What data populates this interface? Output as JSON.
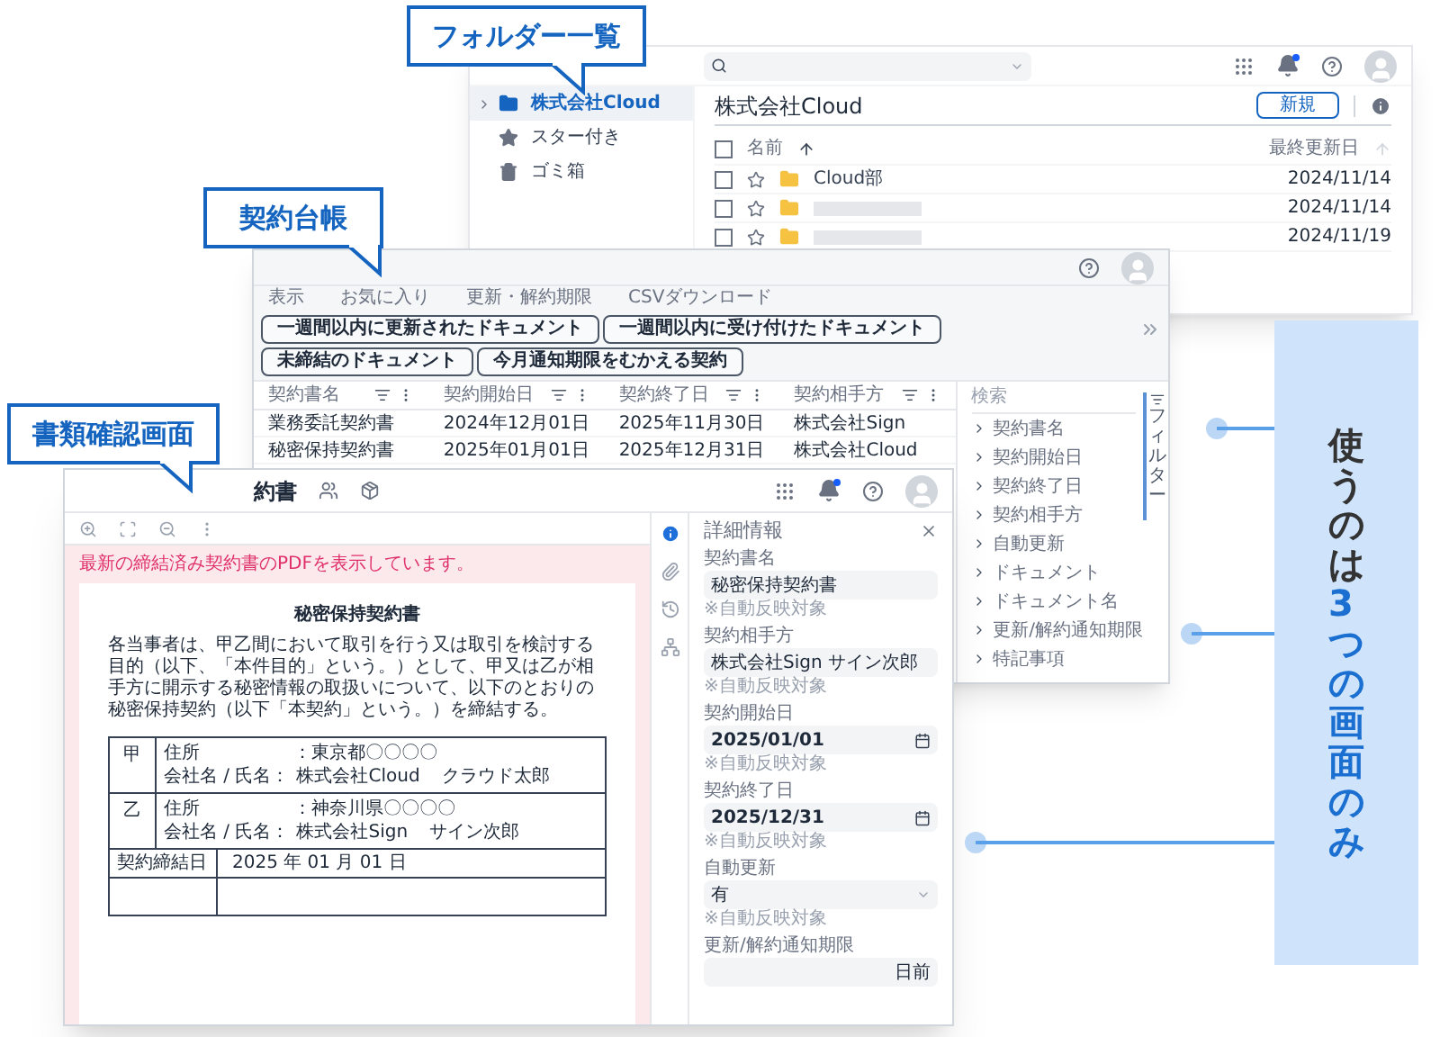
{
  "folder_list": {
    "callout": "フォルダー一覧",
    "notifications": true,
    "sidebar": [
      {
        "label": "株式会社Cloud",
        "kind": "folder",
        "selected": true
      },
      {
        "label": "スター付き",
        "kind": "starred",
        "selected": false
      },
      {
        "label": "ゴミ箱",
        "kind": "trash",
        "selected": false
      }
    ],
    "title": "株式会社Cloud",
    "new_button": "新規",
    "name_column": "名前",
    "date_column": "最終更新日",
    "header_checked": false,
    "rows": [
      {
        "name": "Cloud部",
        "date": "2024/11/14",
        "checked": false,
        "starred": false,
        "redacted": false
      },
      {
        "date": "2024/11/14",
        "checked": false,
        "starred": false,
        "redacted": true
      },
      {
        "date": "2024/11/19",
        "checked": false,
        "starred": false,
        "redacted": true
      }
    ]
  },
  "contract_ledger": {
    "callout": "契約台帳",
    "menu": [
      "表示",
      "お気に入り",
      "更新・解約期限",
      "CSVダウンロード"
    ],
    "chips": [
      "一週間以内に更新されたドキュメント",
      "一週間以内に受け付けたドキュメント",
      "未締結のドキュメント",
      "今月通知期限をむかえる契約"
    ],
    "columns": [
      "契約書名",
      "契約開始日",
      "契約終了日",
      "契約相手方"
    ],
    "rows": [
      [
        "業務委託契約書",
        "2024年12月01日",
        "2025年11月30日",
        "株式会社Sign"
      ],
      [
        "秘密保持契約書",
        "2025年01月01日",
        "2025年12月31日",
        "株式会社Cloud"
      ]
    ],
    "filter_panel": {
      "search_label": "検索",
      "tab": "フィルター",
      "items": [
        "契約書名",
        "契約開始日",
        "契約終了日",
        "契約相手方",
        "自動更新",
        "ドキュメント",
        "ドキュメント名",
        "更新/解約通知期限",
        "特記事項"
      ]
    }
  },
  "doc_viewer": {
    "callout": "書類確認画面",
    "title": "約書",
    "notifications": true,
    "banner": "最新の締結済み契約書のPDFを表示しています。",
    "pdf": {
      "title": "秘密保持契約書",
      "paragraph": "各当事者は、甲乙間において取引を行う又は取引を検討する目的（以下、「本件目的」という。）として、甲又は乙が相手方に開示する秘密情報の取扱いについて、以下のとおりの秘密保持契約（以下「本契約」という。）を締結する。",
      "parties": [
        {
          "mark": "甲",
          "address_label": "住所",
          "address": "：東京都〇〇〇〇",
          "name_label": "会社名 / 氏名：",
          "company": "株式会社Cloud",
          "person": "クラウド太郎"
        },
        {
          "mark": "乙",
          "address_label": "住所",
          "address": "：神奈川県〇〇〇〇",
          "name_label": "会社名 / 氏名：",
          "company": "株式会社Sign",
          "person": "サイン次郎"
        }
      ],
      "date_label": "契約締結日",
      "date_value": "2025 年 01 月 01 日"
    },
    "rail": [
      {
        "kind": "info",
        "selected": true
      },
      {
        "kind": "attachment",
        "selected": false
      },
      {
        "kind": "history",
        "selected": false
      },
      {
        "kind": "tree",
        "selected": false
      }
    ],
    "details": {
      "title": "詳細情報",
      "fields": [
        {
          "label": "契約書名",
          "kind": "text",
          "value": "秘密保持契約書",
          "hint": "※自動反映対象"
        },
        {
          "label": "契約相手方",
          "kind": "text",
          "value": "株式会社Sign サイン次郎",
          "hint": "※自動反映対象"
        },
        {
          "label": "契約開始日",
          "kind": "date",
          "value": "2025/01/01",
          "hint": "※自動反映対象"
        },
        {
          "label": "契約終了日",
          "kind": "date",
          "value": "2025/12/31",
          "hint": "※自動反映対象"
        },
        {
          "label": "自動更新",
          "kind": "select",
          "value": "有",
          "hint": "※自動反映対象"
        },
        {
          "label": "更新/解約通知期限",
          "kind": "days",
          "unit": "日前"
        }
      ]
    }
  },
  "tagline": {
    "lead": "使うのは",
    "highlight": "3つの画面のみ"
  }
}
